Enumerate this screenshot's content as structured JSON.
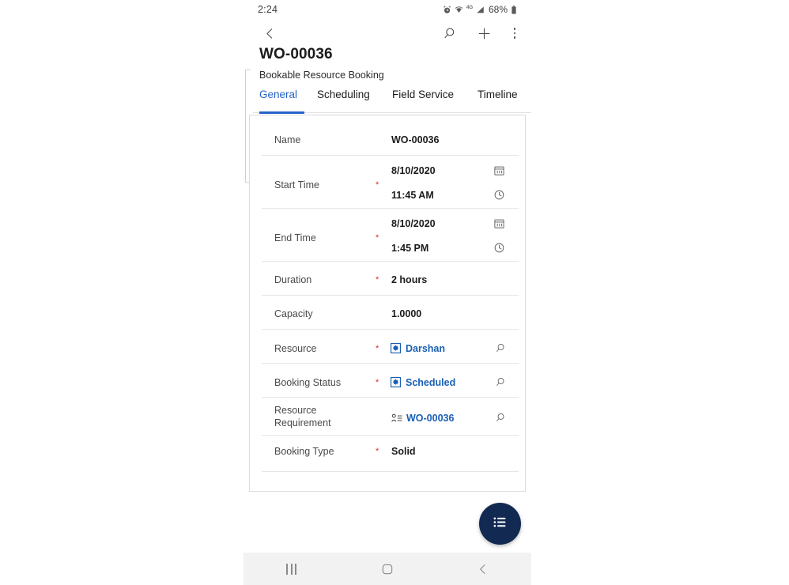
{
  "status_bar": {
    "time": "2:24",
    "battery_percent": "68%",
    "network_label": "4G",
    "icons": [
      "alarm-icon",
      "wifi-icon",
      "network-type-label",
      "signal-icon",
      "battery-icon"
    ]
  },
  "app_bar": {
    "back_icon": "back-chevron-icon",
    "search_icon": "search-icon",
    "add_icon": "plus-icon",
    "more_icon": "overflow-menu-icon"
  },
  "record": {
    "title": "WO-00036",
    "entity_name": "Bookable Resource Booking"
  },
  "tabs": [
    {
      "label": "General",
      "active": true
    },
    {
      "label": "Scheduling",
      "active": false
    },
    {
      "label": "Field Service",
      "active": false
    },
    {
      "label": "Timeline",
      "active": false
    }
  ],
  "form": {
    "fields": [
      {
        "label": "Name",
        "required": false,
        "value": "WO-00036",
        "type": "text"
      },
      {
        "label": "Start Time",
        "required": true,
        "type": "datetime",
        "date": "8/10/2020",
        "time": "11:45 AM",
        "date_icon": "calendar-icon",
        "time_icon": "clock-icon"
      },
      {
        "label": "End Time",
        "required": true,
        "type": "datetime",
        "date": "8/10/2020",
        "time": "1:45 PM",
        "date_icon": "calendar-icon",
        "time_icon": "clock-icon"
      },
      {
        "label": "Duration",
        "required": true,
        "value": "2 hours",
        "type": "text"
      },
      {
        "label": "Capacity",
        "required": false,
        "value": "1.0000",
        "type": "text"
      },
      {
        "label": "Resource",
        "required": true,
        "value": "Darshan",
        "type": "lookup",
        "entity_icon": "entity-record-icon",
        "lookup_icon": "search-icon"
      },
      {
        "label": "Booking Status",
        "required": true,
        "value": "Scheduled",
        "type": "lookup",
        "entity_icon": "entity-record-icon",
        "lookup_icon": "search-icon"
      },
      {
        "label": "Resource Requirement",
        "label_line1": "Resource",
        "label_line2": "Requirement",
        "required": false,
        "value": "WO-00036",
        "type": "lookup",
        "entity_icon": "requirement-icon",
        "lookup_icon": "search-icon"
      },
      {
        "label": "Booking Type",
        "required": true,
        "value": "Solid",
        "type": "text"
      }
    ]
  },
  "fab": {
    "icon": "list-menu-icon",
    "color": "#122a52"
  },
  "nav_bar": {
    "recents_icon": "recents-icon",
    "home_icon": "home-icon",
    "back_icon": "back-icon"
  },
  "colors": {
    "accent": "#2563c9",
    "link": "#1a5fb4",
    "required": "#d93025",
    "fab": "#122a52",
    "divider": "#e6e6e6"
  }
}
